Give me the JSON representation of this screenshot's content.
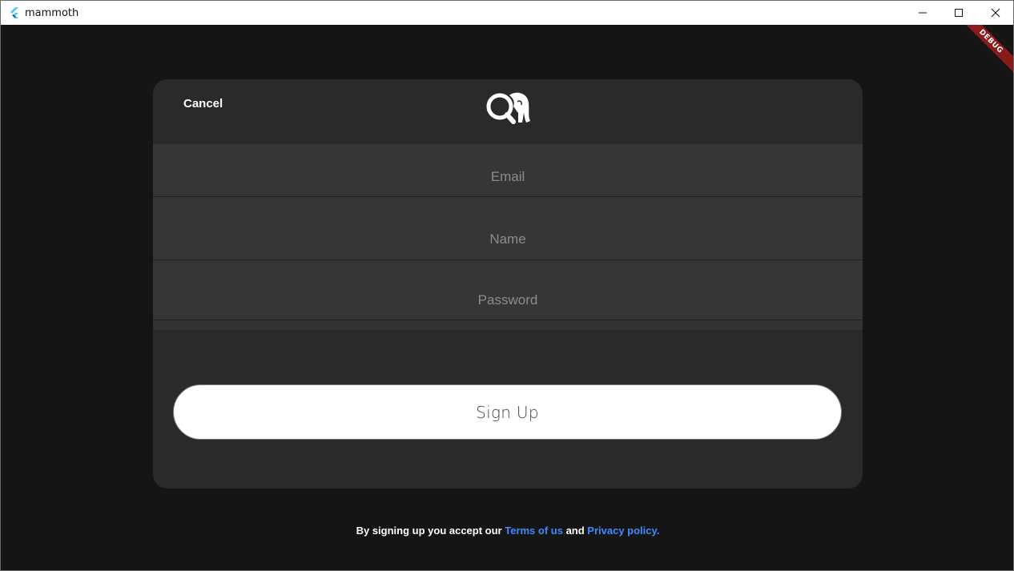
{
  "window": {
    "title": "mammoth",
    "app_icon": "flutter-icon",
    "controls": [
      "minimize-icon",
      "maximize-icon",
      "close-icon"
    ]
  },
  "debug_banner": "DEBUG",
  "header": {
    "cancel_label": "Cancel",
    "logo_icon": "mammoth-logo-icon"
  },
  "form": {
    "email_placeholder": "Email",
    "email_value": "",
    "name_placeholder": "Name",
    "name_value": "",
    "password_placeholder": "Password",
    "password_value": "",
    "submit_label": "Sign Up"
  },
  "footer": {
    "prefix": "By signing up you accept our ",
    "terms_link": "Terms of us",
    "connector": " and ",
    "privacy_link": "Privacy policy."
  },
  "colors": {
    "background": "#151515",
    "card": "#2a2a2a",
    "field": "#363636",
    "link": "#3d8bfd",
    "debug_banner": "#8a1a1a"
  }
}
